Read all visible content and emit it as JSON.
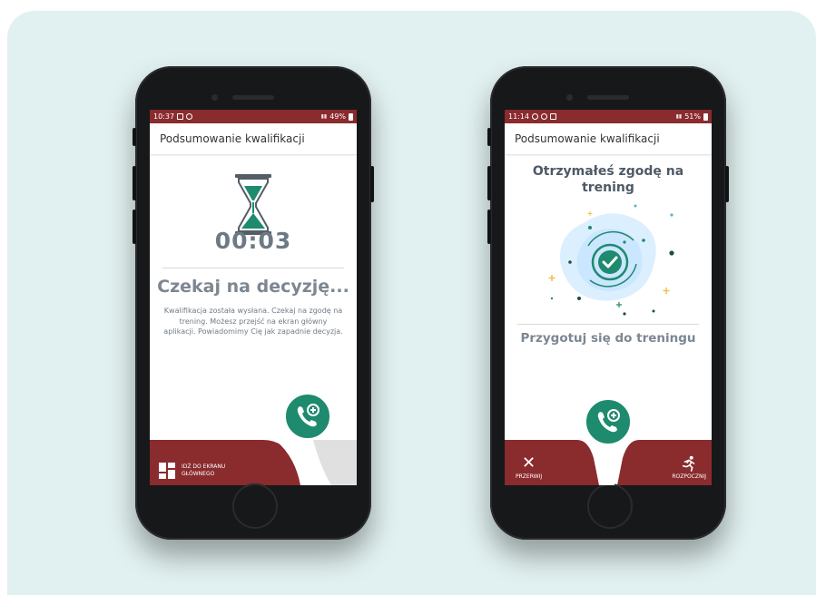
{
  "colors": {
    "brand_red": "#8a2b2e",
    "accent_green": "#1e8a6e",
    "panel_bg": "#e1f0f0"
  },
  "screen1": {
    "status": {
      "time": "10:37",
      "battery": "49%"
    },
    "title": "Podsumowanie kwalifikacji",
    "timer": "00:03",
    "heading": "Czekaj na decyzję...",
    "description": "Kwalifikacja została wysłana. Czekaj na zgodę na trening. Możesz przejść na ekran główny aplikacji. Powiadomimy Cię jak zapadnie decyzja.",
    "home_button_label": "IDŹ DO EKRANU GŁÓWNEGO",
    "icons": {
      "timer": "hourglass-icon",
      "call": "call-plus-icon",
      "home": "grid-icon"
    }
  },
  "screen2": {
    "status": {
      "time": "11:14",
      "battery": "51%"
    },
    "title": "Podsumowanie kwalifikacji",
    "heading": "Otrzymałeś zgodę na trening",
    "subheading": "Przygotuj się do treningu",
    "cancel_label": "PRZERWIJ",
    "start_label": "ROZPOCZNIJ",
    "icons": {
      "approved": "check-circle-icon",
      "call": "call-plus-icon",
      "cancel": "close-icon",
      "start": "running-icon"
    }
  }
}
